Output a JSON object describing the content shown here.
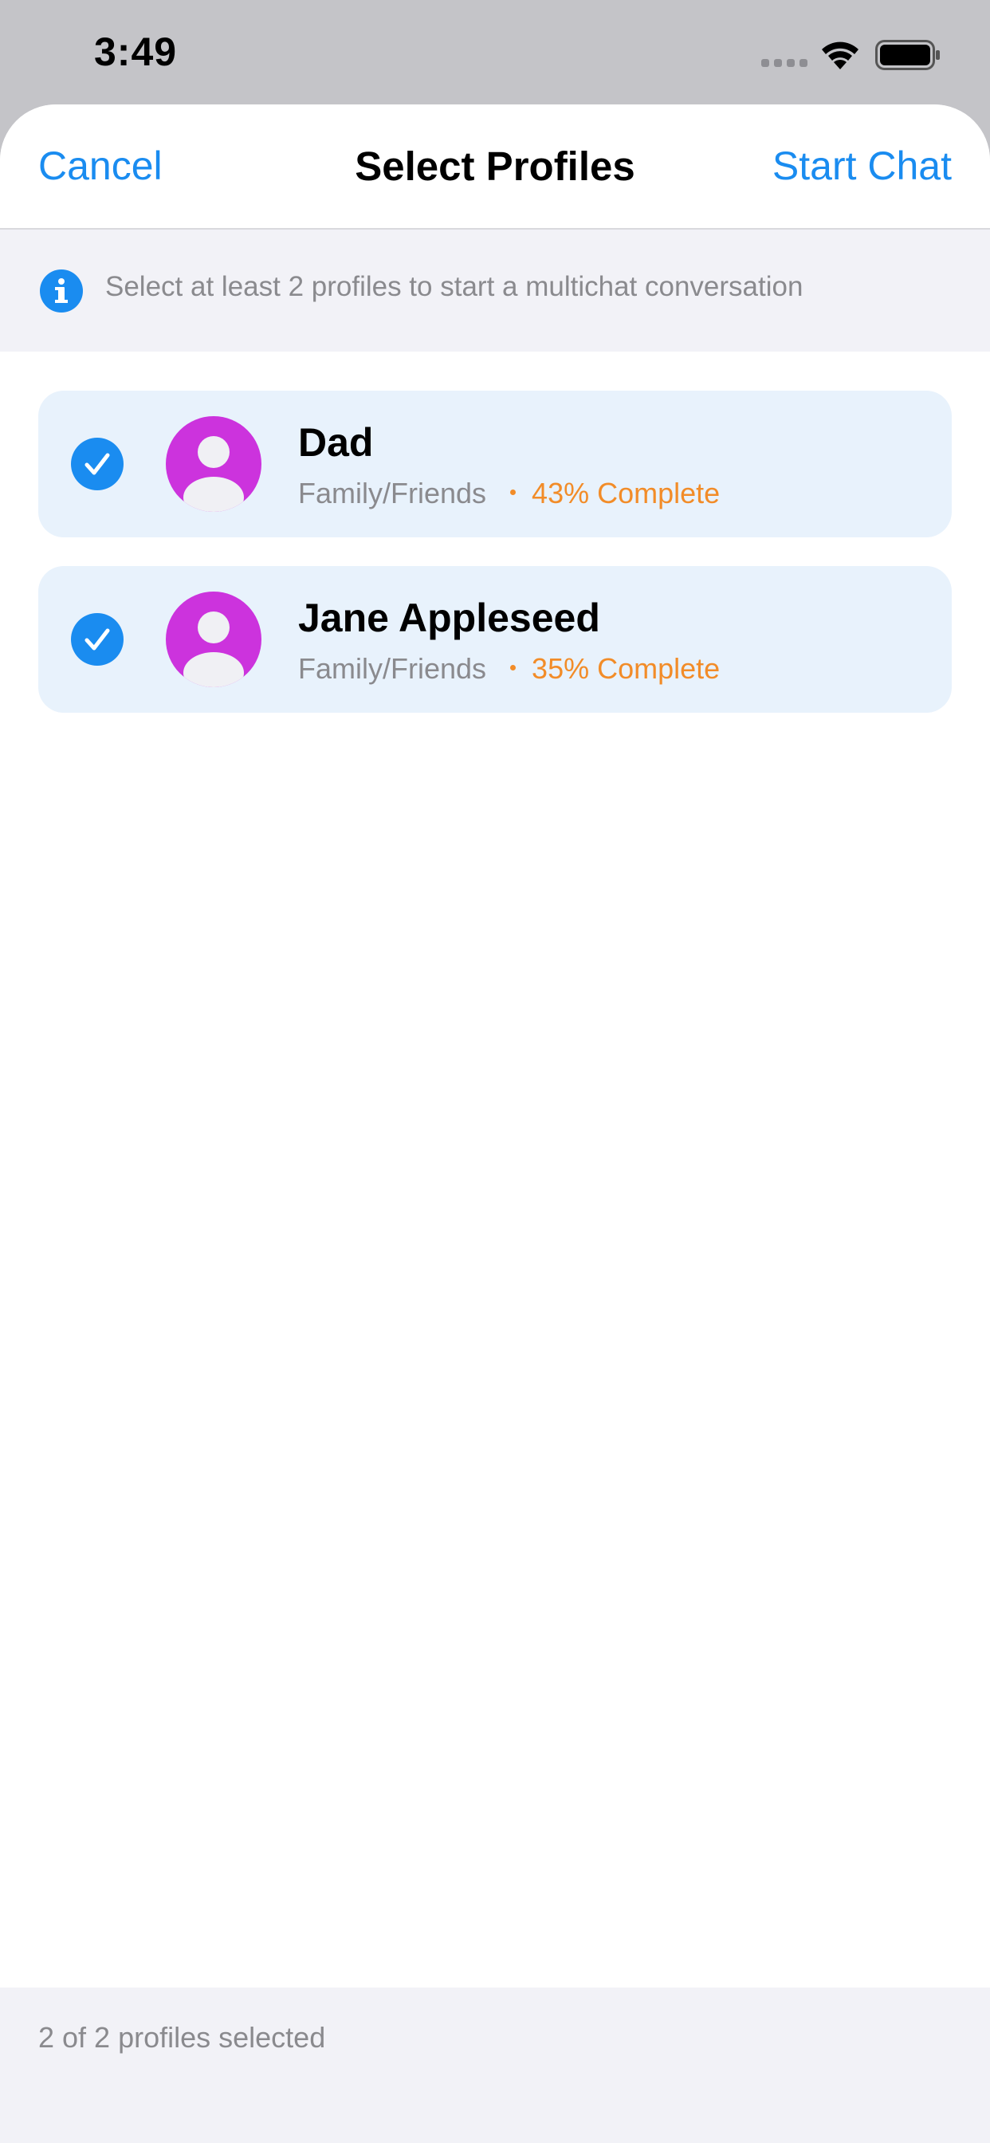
{
  "status_bar": {
    "time": "3:49"
  },
  "nav": {
    "cancel_label": "Cancel",
    "title": "Select Profiles",
    "start_label": "Start Chat"
  },
  "info": {
    "icon": "info-icon",
    "text": "Select at least 2 profiles to start a multichat conversation"
  },
  "profiles": [
    {
      "name": "Dad",
      "category": "Family/Friends",
      "progress": "43% Complete",
      "selected": true
    },
    {
      "name": "Jane Appleseed",
      "category": "Family/Friends",
      "progress": "35% Complete",
      "selected": true
    }
  ],
  "footer": {
    "selection_text": "2 of 2 profiles selected"
  },
  "colors": {
    "accent": "#1a8cf0",
    "avatar": "#cc33dd",
    "progress": "#f28c28",
    "card_background": "#e8f2fc"
  }
}
